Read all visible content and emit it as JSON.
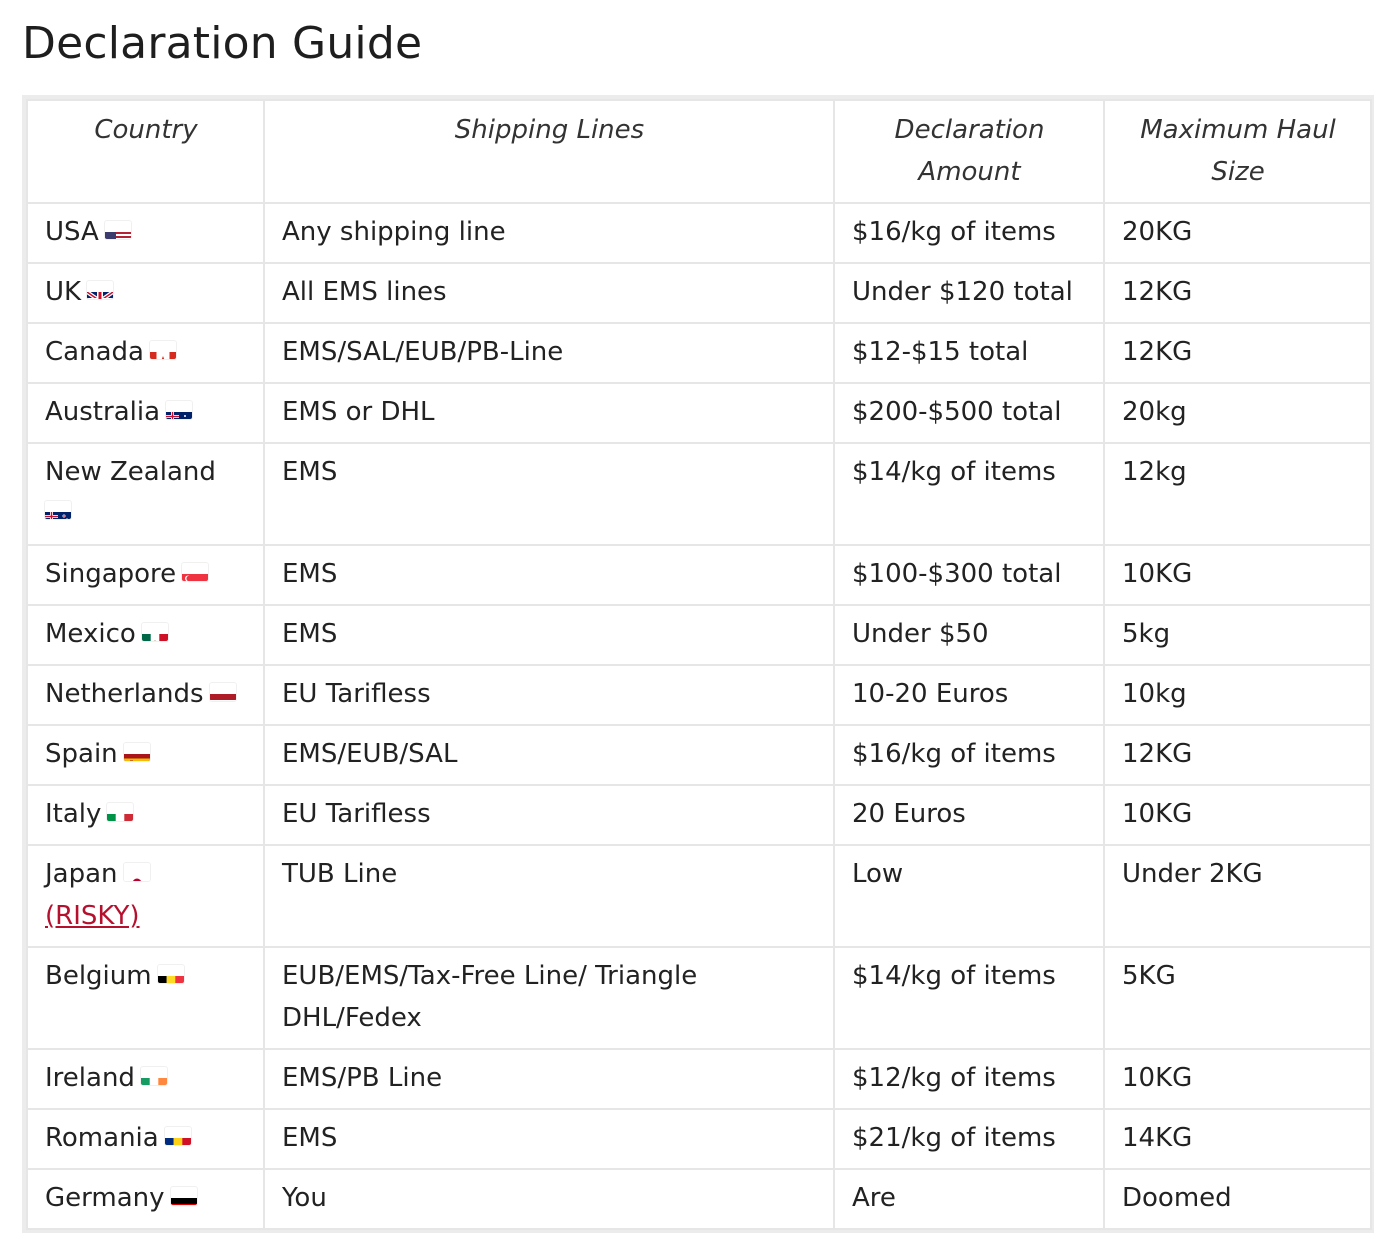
{
  "title": "Declaration Guide",
  "columns": [
    "Country",
    "Shipping Lines",
    "Declaration Amount",
    "Maximum Haul Size"
  ],
  "rows": [
    {
      "country": "USA",
      "flag": "us-flag-icon",
      "lines": "Any shipping line",
      "amount": "$16/kg of items",
      "size": "20KG"
    },
    {
      "country": "UK",
      "flag": "uk-flag-icon",
      "lines": "All EMS lines",
      "amount": "Under $120 total",
      "size": "12KG"
    },
    {
      "country": "Canada",
      "flag": "canada-flag-icon",
      "lines": "EMS/SAL/EUB/PB-Line",
      "amount": "$12-$15 total",
      "size": "12KG"
    },
    {
      "country": "Australia",
      "flag": "australia-flag-icon",
      "lines": "EMS or DHL",
      "amount": "$200-$500 total",
      "size": "20kg"
    },
    {
      "country": "New Zealand",
      "flag": "new-zealand-flag-icon",
      "lines": "EMS",
      "amount": "$14/kg of items",
      "size": "12kg"
    },
    {
      "country": "Singapore",
      "flag": "singapore-flag-icon",
      "lines": "EMS",
      "amount": "$100-$300 total",
      "size": "10KG"
    },
    {
      "country": "Mexico",
      "flag": "mexico-flag-icon",
      "lines": "EMS",
      "amount": "Under $50",
      "size": "5kg"
    },
    {
      "country": "Netherlands",
      "flag": "netherlands-flag-icon",
      "lines": "EU Tarifless",
      "amount": "10-20 Euros",
      "size": "10kg"
    },
    {
      "country": "Spain",
      "flag": "spain-flag-icon",
      "lines": "EMS/EUB/SAL",
      "amount": "$16/kg of items",
      "size": "12KG"
    },
    {
      "country": "Italy",
      "flag": "italy-flag-icon",
      "lines": "EU Tarifless",
      "amount": "20 Euros",
      "size": "10KG"
    },
    {
      "country": "Japan",
      "flag": "japan-flag-icon",
      "note": "(RISKY)",
      "lines": "TUB Line",
      "amount": "Low",
      "size": "Under 2KG"
    },
    {
      "country": "Belgium",
      "flag": "belgium-flag-icon",
      "lines": "EUB/EMS/Tax-Free Line/ Triangle DHL/Fedex",
      "amount": "$14/kg of items",
      "size": "5KG"
    },
    {
      "country": "Ireland",
      "flag": "ireland-flag-icon",
      "lines": "EMS/PB Line",
      "amount": "$12/kg of items",
      "size": "10KG"
    },
    {
      "country": "Romania",
      "flag": "romania-flag-icon",
      "lines": "EMS",
      "amount": "$21/kg of items",
      "size": "14KG"
    },
    {
      "country": "Germany",
      "flag": "germany-flag-icon",
      "lines": "You",
      "amount": "Are",
      "size": "Doomed"
    }
  ],
  "colors": {
    "link": "#b5112f",
    "border": "#e6e6e6",
    "frame": "#ececec"
  }
}
